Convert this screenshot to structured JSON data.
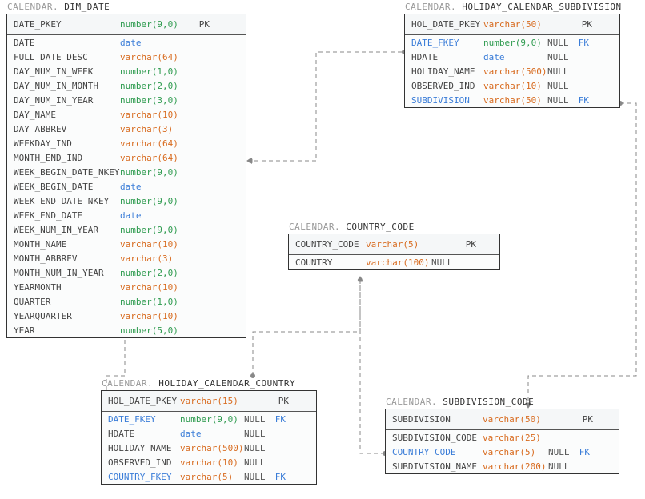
{
  "schema": "CALENDAR",
  "tables": {
    "dim_date": {
      "name": "DIM_DATE",
      "header": {
        "col": "DATE_PKEY",
        "type": "number(9,0)",
        "typeClass": "t-num",
        "key": "PK"
      },
      "rows": [
        {
          "col": "DATE",
          "type": "date",
          "typeClass": "t-date"
        },
        {
          "col": "FULL_DATE_DESC",
          "type": "varchar(64)",
          "typeClass": "t-str"
        },
        {
          "col": "DAY_NUM_IN_WEEK",
          "type": "number(1,0)",
          "typeClass": "t-num"
        },
        {
          "col": "DAY_NUM_IN_MONTH",
          "type": "number(2,0)",
          "typeClass": "t-num"
        },
        {
          "col": "DAY_NUM_IN_YEAR",
          "type": "number(3,0)",
          "typeClass": "t-num"
        },
        {
          "col": "DAY_NAME",
          "type": "varchar(10)",
          "typeClass": "t-str"
        },
        {
          "col": "DAY_ABBREV",
          "type": "varchar(3)",
          "typeClass": "t-str"
        },
        {
          "col": "WEEKDAY_IND",
          "type": "varchar(64)",
          "typeClass": "t-str"
        },
        {
          "col": "MONTH_END_IND",
          "type": "varchar(64)",
          "typeClass": "t-str"
        },
        {
          "col": "WEEK_BEGIN_DATE_NKEY",
          "type": "number(9,0)",
          "typeClass": "t-num"
        },
        {
          "col": "WEEK_BEGIN_DATE",
          "type": "date",
          "typeClass": "t-date"
        },
        {
          "col": "WEEK_END_DATE_NKEY",
          "type": "number(9,0)",
          "typeClass": "t-num"
        },
        {
          "col": "WEEK_END_DATE",
          "type": "date",
          "typeClass": "t-date"
        },
        {
          "col": "WEEK_NUM_IN_YEAR",
          "type": "number(9,0)",
          "typeClass": "t-num"
        },
        {
          "col": "MONTH_NAME",
          "type": "varchar(10)",
          "typeClass": "t-str"
        },
        {
          "col": "MONTH_ABBREV",
          "type": "varchar(3)",
          "typeClass": "t-str"
        },
        {
          "col": "MONTH_NUM_IN_YEAR",
          "type": "number(2,0)",
          "typeClass": "t-num"
        },
        {
          "col": "YEARMONTH",
          "type": "varchar(10)",
          "typeClass": "t-str"
        },
        {
          "col": "QUARTER",
          "type": "number(1,0)",
          "typeClass": "t-num"
        },
        {
          "col": "YEARQUARTER",
          "type": "varchar(10)",
          "typeClass": "t-str"
        },
        {
          "col": "YEAR",
          "type": "number(5,0)",
          "typeClass": "t-num"
        }
      ]
    },
    "hol_sub": {
      "name": "HOLIDAY_CALENDAR_SUBDIVISION",
      "header": {
        "col": "HOL_DATE_PKEY",
        "type": "varchar(50)",
        "typeClass": "t-str",
        "key": "PK"
      },
      "rows": [
        {
          "col": "DATE_FKEY",
          "type": "number(9,0)",
          "typeClass": "t-num",
          "null": "NULL",
          "fk": "FK",
          "isFk": true
        },
        {
          "col": "HDATE",
          "type": "date",
          "typeClass": "t-date",
          "null": "NULL"
        },
        {
          "col": "HOLIDAY_NAME",
          "type": "varchar(500)",
          "typeClass": "t-str",
          "null": "NULL"
        },
        {
          "col": "OBSERVED_IND",
          "type": "varchar(10)",
          "typeClass": "t-str",
          "null": "NULL"
        },
        {
          "col": "SUBDIVISION",
          "type": "varchar(50)",
          "typeClass": "t-str",
          "null": "NULL",
          "fk": "FK",
          "isFk": true
        }
      ]
    },
    "country_code": {
      "name": "COUNTRY_CODE",
      "header": {
        "col": "COUNTRY_CODE",
        "type": "varchar(5)",
        "typeClass": "t-str",
        "key": "PK"
      },
      "rows": [
        {
          "col": "COUNTRY",
          "type": "varchar(100)",
          "typeClass": "t-str",
          "null": "NULL"
        }
      ]
    },
    "hol_country": {
      "name": "HOLIDAY_CALENDAR_COUNTRY",
      "header": {
        "col": "HOL_DATE_PKEY",
        "type": "varchar(15)",
        "typeClass": "t-str",
        "key": "PK"
      },
      "rows": [
        {
          "col": "DATE_FKEY",
          "type": "number(9,0)",
          "typeClass": "t-num",
          "null": "NULL",
          "fk": "FK",
          "isFk": true
        },
        {
          "col": "HDATE",
          "type": "date",
          "typeClass": "t-date",
          "null": "NULL"
        },
        {
          "col": "HOLIDAY_NAME",
          "type": "varchar(500)",
          "typeClass": "t-str",
          "null": "NULL"
        },
        {
          "col": "OBSERVED_IND",
          "type": "varchar(10)",
          "typeClass": "t-str",
          "null": "NULL"
        },
        {
          "col": "COUNTRY_FKEY",
          "type": "varchar(5)",
          "typeClass": "t-str",
          "null": "NULL",
          "fk": "FK",
          "isFk": true
        }
      ]
    },
    "subdiv_code": {
      "name": "SUBDIVISION_CODE",
      "header": {
        "col": "SUBDIVISION",
        "type": "varchar(50)",
        "typeClass": "t-str",
        "key": "PK"
      },
      "rows": [
        {
          "col": "SUBDIVISION_CODE",
          "type": "varchar(25)",
          "typeClass": "t-str"
        },
        {
          "col": "COUNTRY_CODE",
          "type": "varchar(5)",
          "typeClass": "t-str",
          "null": "NULL",
          "fk": "FK",
          "isFk": true
        },
        {
          "col": "SUBDIVISION_NAME",
          "type": "varchar(200)",
          "typeClass": "t-str",
          "null": "NULL"
        }
      ]
    }
  }
}
